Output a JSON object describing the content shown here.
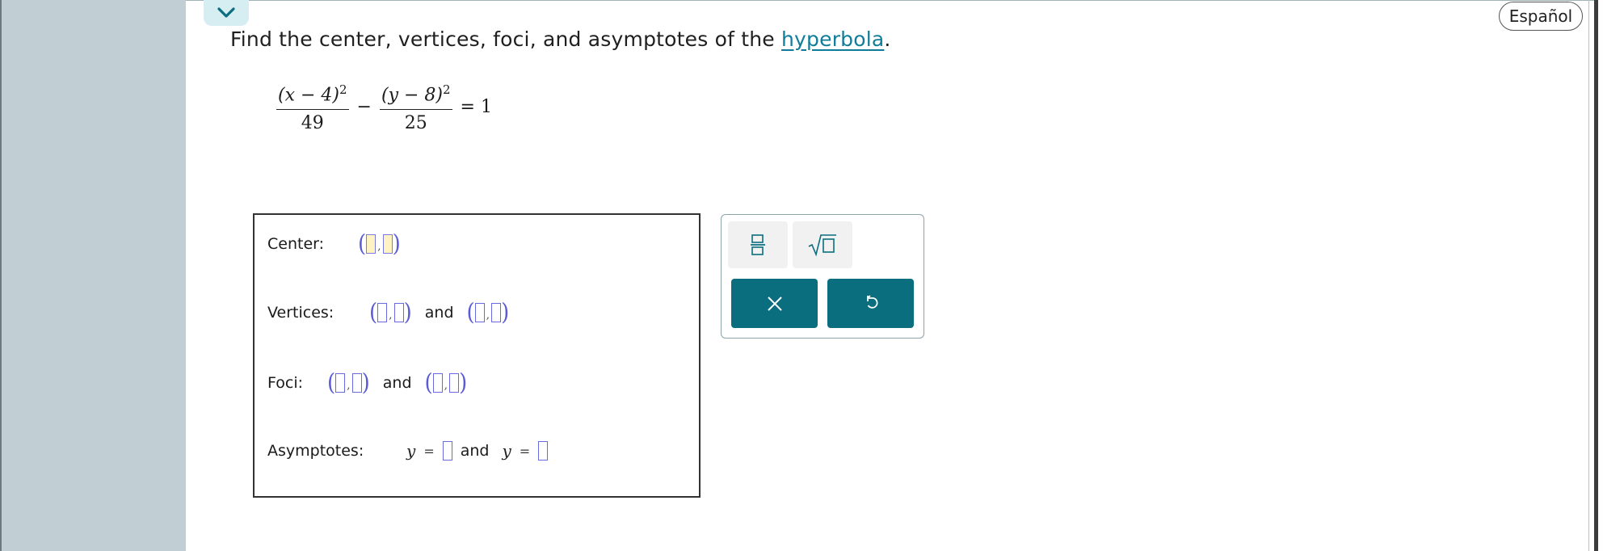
{
  "header": {
    "collapse_icon": "chevron-down-icon",
    "language_button": "Español"
  },
  "question": {
    "prefix": "Find the center, vertices, foci, and asymptotes of the ",
    "link_text": "hyperbola",
    "suffix": "."
  },
  "equation": {
    "term1_numerator": "(x − 4)",
    "term1_exponent": "2",
    "term1_denominator": "49",
    "minus": "−",
    "term2_numerator": "(y − 8)",
    "term2_exponent": "2",
    "term2_denominator": "25",
    "equals": "= 1"
  },
  "answer": {
    "center_label": "Center:",
    "vertices_label": "Vertices:",
    "foci_label": "Foci:",
    "asymptotes_label": "Asymptotes:",
    "and_text": "and",
    "y_var": "y",
    "equals_sign": "="
  },
  "toolbar": {
    "fraction_icon": "fraction-icon",
    "sqrt_icon": "square-root-icon",
    "clear_icon": "close-icon",
    "undo_icon": "undo-icon"
  },
  "colors": {
    "left_panel": "#c1ced3",
    "link": "#0f7d9a",
    "action_button": "#0b6e7f",
    "input_border": "#6a6adf",
    "active_input": "#fff3c4"
  }
}
